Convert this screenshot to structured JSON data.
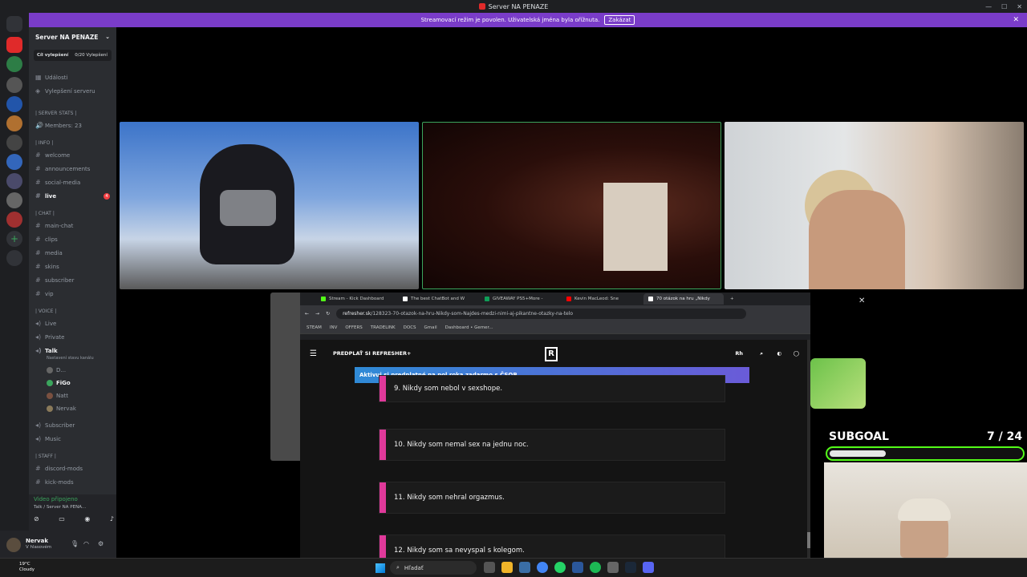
{
  "window": {
    "title": "Server NA PENAZE"
  },
  "banner": {
    "text": "Streamovací režim je povolen. Uživatelská jména byla ořížnuta.",
    "button": "Zakázat"
  },
  "server": {
    "name": "Server NA PENAZE",
    "boost_goal": "Cíl vylepšení",
    "boost_progress": "0/20 Vylepšení",
    "events": "Události",
    "server_boost": "Vylepšení serveru"
  },
  "channels": {
    "stats_cat": "| SERVER STATS |",
    "members": "Members: 23",
    "info_cat": "| Info |",
    "welcome": "welcome",
    "announcements": "announcements",
    "social": "social-media",
    "live": "live",
    "live_badge": "4",
    "chat_cat": "| chat |",
    "main_chat": "main-chat",
    "clips": "clips",
    "media": "media",
    "skins": "skins",
    "subscriber": "subscriber",
    "vip": "vip",
    "voice_cat": "| Voice |",
    "v_live": "Live",
    "v_private": "Private",
    "v_talk": "Talk",
    "talk_status": "Nastavení stavu kanálu",
    "voice_users": [
      "D...",
      "FiGo",
      "Natt",
      "Nervak"
    ],
    "v_subscriber": "Subscriber",
    "v_music": "Music",
    "staff_cat": "| Staff |",
    "discord_mods": "discord-mods",
    "kick_mods": "kick-mods"
  },
  "voice_connected": {
    "status": "Video připojeno",
    "location": "Talk / Server NA PENA..."
  },
  "user": {
    "name": "Nervak",
    "status": "V hlasovém"
  },
  "browser": {
    "tabs": [
      "Stream - Kick Dashboard",
      "The best ChatBot and W",
      "GIVEAWAY PS5+More - ",
      "Kevin MacLeod: Sne",
      "70 otázok na hru „Nikdy"
    ],
    "url_host": "refresher.sk",
    "url_path": "/128323-70-otazok-na-hru-Nikdy-som-Najdes-medzi-nimi-aj-pikantne-otazky-na-telo",
    "bookmarks": [
      "STEAM",
      "INV",
      "OFFERS",
      "TRADELINK",
      "DOCS",
      "Gmail",
      "Dashboard • Gemer..."
    ],
    "site_cta": "PREDPLAŤ SI REFRESHER+",
    "site_logo": "R",
    "promo": "Aktivuj si predplatné na pol roka zadarmo s ČSOB",
    "questions": [
      "9. Nikdy som nebol v sexshope.",
      "10. Nikdy som nemal sex na jednu noc.",
      "11. Nikdy som nehral orgazmus.",
      "12. Nikdy som sa nevyspal s kolegom."
    ]
  },
  "subgoal": {
    "label": "SUBGOAL",
    "count": "7 / 24",
    "current": 7,
    "target": 24
  },
  "taskbar": {
    "temp": "19°C",
    "weather": "Cloudy",
    "search": "Hľadať"
  },
  "colors": {
    "accent": "#53fc18",
    "banner": "#7a3cc9",
    "question_bar": "#e0399a"
  }
}
